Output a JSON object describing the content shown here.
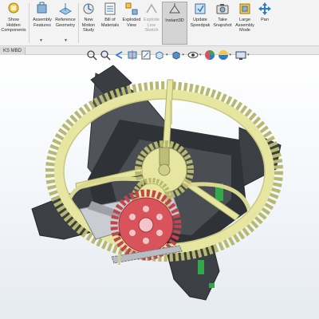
{
  "ribbon": {
    "items": [
      {
        "label": "Show\nHidden\nComponents",
        "enabled": true
      },
      {
        "label": "Assembly\nFeatures",
        "enabled": true
      },
      {
        "label": "Reference\nGeometry",
        "enabled": true
      },
      {
        "label": "New\nMotion\nStudy",
        "enabled": true
      },
      {
        "label": "Bill of\nMaterials",
        "enabled": true
      },
      {
        "label": "Exploded\nView",
        "enabled": true
      },
      {
        "label": "Explode\nLine\nSketch",
        "enabled": false
      },
      {
        "label": "Instant3D",
        "enabled": true,
        "active": true
      },
      {
        "label": "Update\nSpeedpak",
        "enabled": true
      },
      {
        "label": "Take\nSnapshot",
        "enabled": true
      },
      {
        "label": "Large\nAssembly\nMode",
        "enabled": true
      },
      {
        "label": "Pan",
        "enabled": true
      }
    ]
  },
  "doc_tab": {
    "label": "KS MBD"
  },
  "view_toolbar": {
    "icons": [
      "zoom-to-fit-icon",
      "zoom-to-area-icon",
      "previous-view-icon",
      "section-view-icon",
      "dynamic-annotation-view-icon",
      "view-orientation-icon",
      "display-style-icon",
      "hide-show-items-icon",
      "edit-appearance-icon",
      "apply-scene-icon",
      "view-settings-icon"
    ]
  },
  "colors": {
    "ribbon_bg": "#f3f3f3",
    "gear_yellow": "#e6e6a0",
    "gear_red": "#d9535a",
    "frame_dark": "#3c3f44",
    "pin_green": "#33a84a",
    "active_button": "#d4d4d4"
  }
}
